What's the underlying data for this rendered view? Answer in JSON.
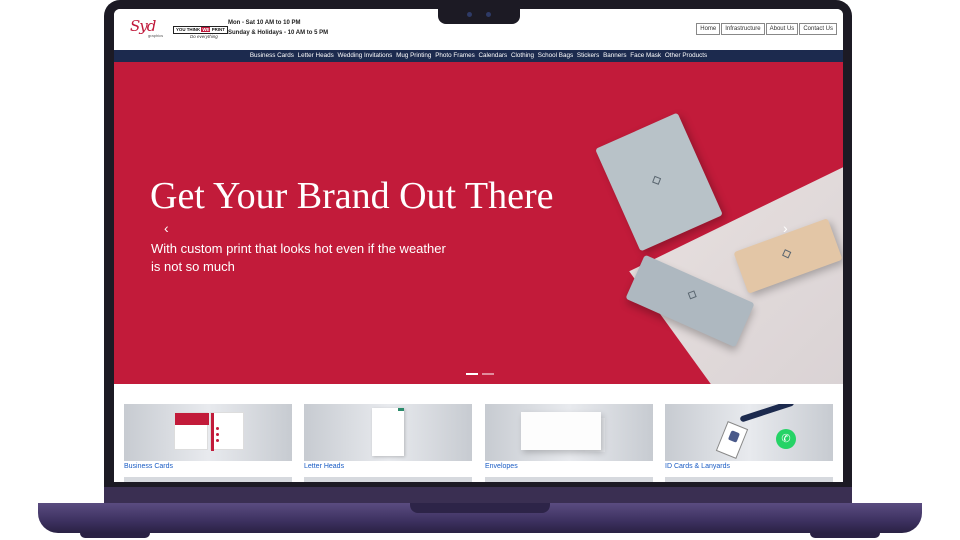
{
  "header": {
    "logo_text": "Syd",
    "logo_sub": "graphics",
    "tagline_prefix": "YOU THINK",
    "tagline_we": "WE",
    "tagline_suffix": "PRINT",
    "tagline_script": "Do everything",
    "hours_line1": "Mon - Sat 10 AM to 10 PM",
    "hours_line2": "Sunday & Holidays - 10 AM to 5 PM",
    "nav": [
      "Home",
      "Infrastructure",
      "About Us",
      "Contact Us"
    ]
  },
  "categories": [
    "Business Cards",
    "Letter Heads",
    "Wedding Invitations",
    "Mug Printing",
    "Photo Frames",
    "Calendars",
    "Clothing",
    "School Bags",
    "Stickers",
    "Banners",
    "Face Mask",
    "Other Products"
  ],
  "hero": {
    "title": "Get Your Brand Out There",
    "subtitle": "With custom print that looks hot even if the weather is not so much",
    "prev_icon": "‹",
    "next_icon": "›",
    "active_slide": 1,
    "slide_count": 2
  },
  "products": [
    {
      "label": "Business Cards"
    },
    {
      "label": "Letter Heads"
    },
    {
      "label": "Envelopes"
    },
    {
      "label": "ID Cards & Lanyards"
    }
  ],
  "whatsapp_icon": "✆",
  "colors": {
    "brand_red": "#c21b3a",
    "nav_bar": "#1c2a4e",
    "link_blue": "#1a5cc4",
    "laptop_body": "#3d3160"
  }
}
